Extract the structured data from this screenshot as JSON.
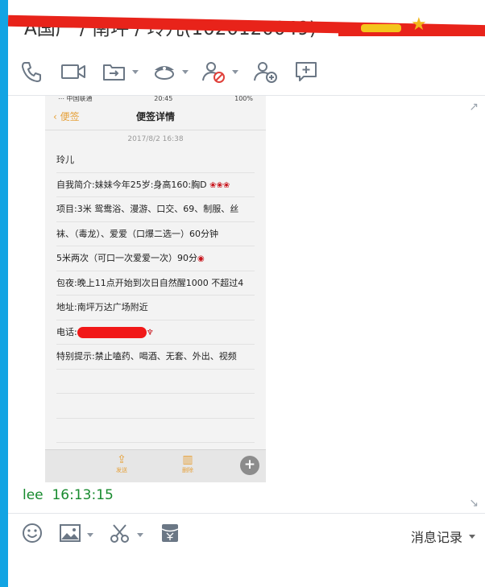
{
  "window": {
    "title_text": "A国产 / 南坪 / 玲儿(1020120049)"
  },
  "toolbar_top": {
    "icons": [
      "phone-icon",
      "video-icon",
      "file-transfer-icon",
      "app-icon",
      "block-user-icon",
      "add-contact-icon",
      "new-message-icon"
    ]
  },
  "phone": {
    "status_left": "⋯ 中国联通",
    "status_time": "20:45",
    "status_right": "100%",
    "nav_back": "便签",
    "nav_title": "便签详情",
    "date": "2017/8/2 16:38",
    "lines": [
      "玲儿",
      "自我简介:妹妹今年25岁:身高160:胸D",
      "项目:3米   鸳鸯浴、漫游、口交、69、制服、丝",
      "袜、（毒龙）、爱爱（口爆二选一）60分钟",
      "5米两次（可口一次爱爱一次）90分",
      "包夜:晚上11点开始到次日自然醒1000    不超过4",
      "地址:南坪万达广场附近",
      "电话:",
      "特别提示:禁止嗑药、喝酒、无套、外出、视频"
    ],
    "bottom_send": "发送",
    "bottom_delete": "删除"
  },
  "message": {
    "sender": "lee",
    "time": "16:13:15"
  },
  "toolbar_bottom": {
    "history_label": "消息记录"
  }
}
